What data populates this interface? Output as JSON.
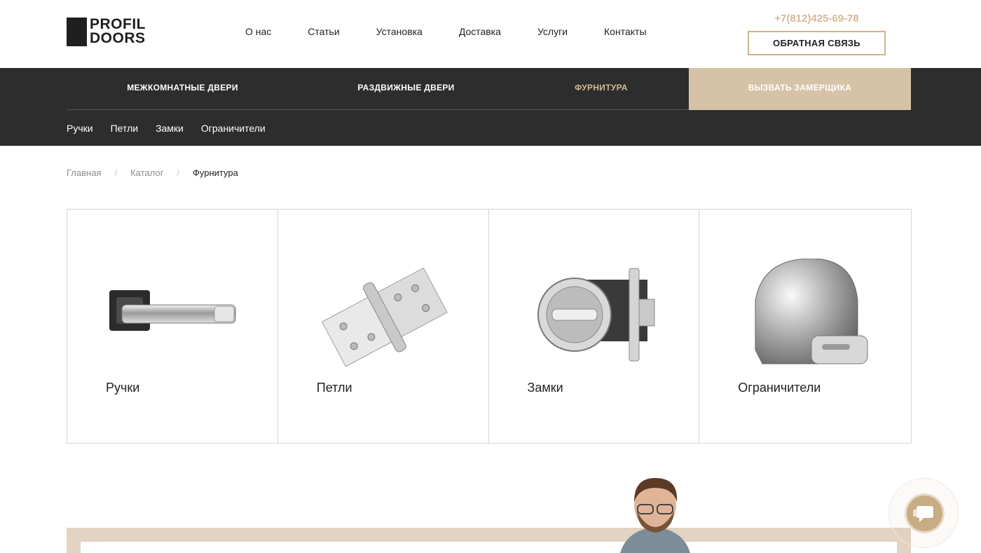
{
  "header": {
    "logo": {
      "line1": "PROFIL",
      "line2": "DOORS"
    },
    "nav": [
      "О нас",
      "Статьи",
      "Установка",
      "Доставка",
      "Услуги",
      "Контакты"
    ],
    "phone": "+7(812)425-69-78",
    "callback_label": "ОБРАТНАЯ СВЯЗЬ"
  },
  "main_nav": {
    "items": [
      {
        "label": "МЕЖКОМНАТНЫЕ ДВЕРИ",
        "active": false
      },
      {
        "label": "РАЗДВИЖНЫЕ ДВЕРИ",
        "active": false
      },
      {
        "label": "ФУРНИТУРА",
        "active": true
      }
    ],
    "cta_label": "ВЫЗВАТЬ ЗАМЕРЩИКА",
    "sub_items": [
      "Ручки",
      "Петли",
      "Замки",
      "Ограничители"
    ]
  },
  "breadcrumb": {
    "items": [
      "Главная",
      "Каталог"
    ],
    "separator": "/",
    "current": "Фурнитура"
  },
  "categories": [
    {
      "label": "Ручки",
      "icon": "door-handle-icon"
    },
    {
      "label": "Петли",
      "icon": "door-hinge-icon"
    },
    {
      "label": "Замки",
      "icon": "door-lock-icon"
    },
    {
      "label": "Ограничители",
      "icon": "door-stopper-icon"
    }
  ],
  "colors": {
    "accent": "#d6b895",
    "dark_nav": "#2d2d2d",
    "cta_bg": "#d6c3a7"
  }
}
